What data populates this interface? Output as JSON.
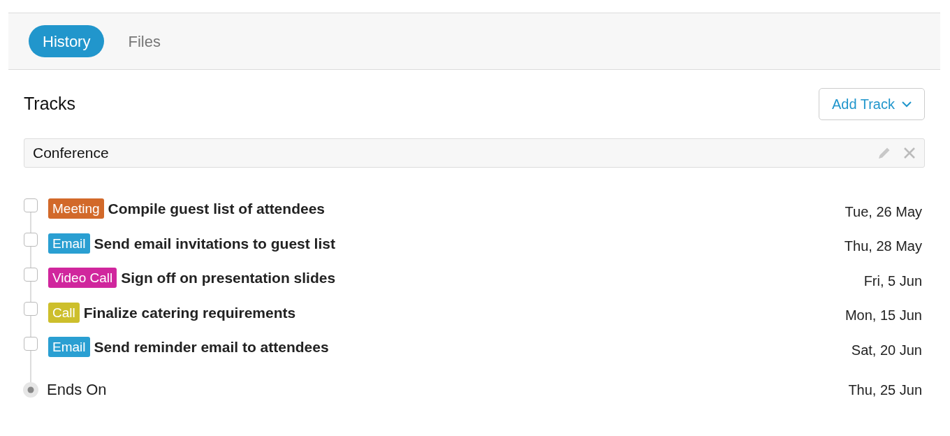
{
  "tabs": [
    {
      "label": "History",
      "selected": true
    },
    {
      "label": "Files",
      "selected": false
    }
  ],
  "section": {
    "title": "Tracks",
    "add_button": "Add Track"
  },
  "track": {
    "name": "Conference",
    "tasks": [
      {
        "checked": false,
        "tag": "Meeting",
        "color": "#d2692a",
        "title": "Compile guest list of attendees",
        "date": "Tue, 26 May"
      },
      {
        "checked": false,
        "tag": "Email",
        "color": "#2a9fd2",
        "title": "Send email invitations to guest list",
        "date": "Thu, 28 May"
      },
      {
        "checked": false,
        "tag": "Video Call",
        "color": "#d0269d",
        "title": "Sign off on presentation slides",
        "date": "Fri, 5 Jun"
      },
      {
        "checked": false,
        "tag": "Call",
        "color": "#cdbf2c",
        "title": "Finalize catering requirements",
        "date": "Mon, 15 Jun"
      },
      {
        "checked": false,
        "tag": "Email",
        "color": "#2a9fd2",
        "title": "Send reminder email to attendees",
        "date": "Sat, 20 Jun"
      }
    ],
    "end": {
      "label": "Ends On",
      "date": "Thu, 25 Jun"
    }
  }
}
